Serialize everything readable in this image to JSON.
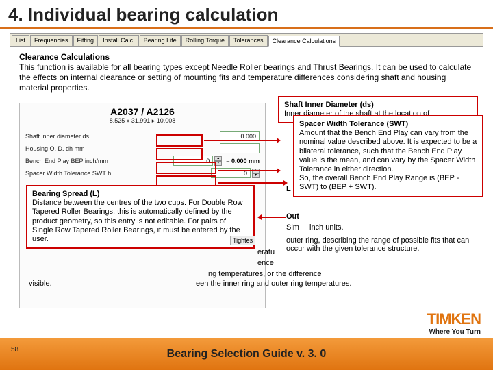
{
  "header": {
    "title": "4. Individual bearing calculation"
  },
  "tabs": [
    "List",
    "Frequencies",
    "Fitting",
    "Install Calc.",
    "Bearing Life",
    "Rolling Torque",
    "Tolerances",
    "Clearance Calculations"
  ],
  "intro": {
    "heading": "Clearance Calculations",
    "body": "This function is available for all bearing types except Needle Roller bearings and Thrust Bearings. It can be used to calculate the effects on internal clearance or setting of mounting fits and temperature differences considering shaft and housing material properties."
  },
  "app": {
    "name": "A2037 / A2126",
    "dims": "8.525 x 31.991 ▸ 10.008",
    "rows": [
      {
        "label": "Shaft inner diameter ds",
        "value": "0.000"
      },
      {
        "label": "Housing O. D. dh   mm",
        "value": ""
      },
      {
        "label": "Bench End Play BEP   inch/mm",
        "value": "0",
        "unit": "= 0.000 mm"
      },
      {
        "label": "Spacer Width Tolerance SWT h",
        "value": "0"
      }
    ],
    "tightestLabel": "Tightes"
  },
  "callouts": {
    "shaft": {
      "title": "Shaft Inner Diameter (ds)",
      "body": "Inner diameter of the shaft at the location of"
    },
    "swt": {
      "title": "Spacer Width Tolerance (SWT)",
      "body": "Amount that the Bench End Play can vary from the nominal value described above. It is expected to be a bilateral tolerance, such that the Bench End Play value is the mean, and can vary by the Spacer Width Tolerance in either direction.\nSo, the overall Bench End Play Range is (BEP - SWT) to (BEP + SWT)."
    },
    "spread": {
      "title": "Bearing Spread (L)",
      "body": "Distance between the centres of the two cups. For Double Row Tapered Roller Bearings, this is automatically defined by the product geometry, so this entry is not editable. For pairs of Single Row Tapered Roller Bearings, it must be entered by the user."
    },
    "inchunits": "inch units.",
    "visible": "visible.",
    "outer": "Out",
    "sim": "Sim",
    "temperatu": "eratu",
    "frag1": "outer ring, describing the range of possible fits that can occur with the given tolerance structure.",
    "frag2": "ng temperatures, or the difference",
    "frag3": "een the inner ring and outer ring temperatures.",
    "ence": "ence"
  },
  "footer": {
    "page": "58",
    "title": "Bearing Selection Guide v. 3. 0"
  },
  "brand": {
    "logo": "TIMKEN",
    "tag": "Where You Turn"
  }
}
